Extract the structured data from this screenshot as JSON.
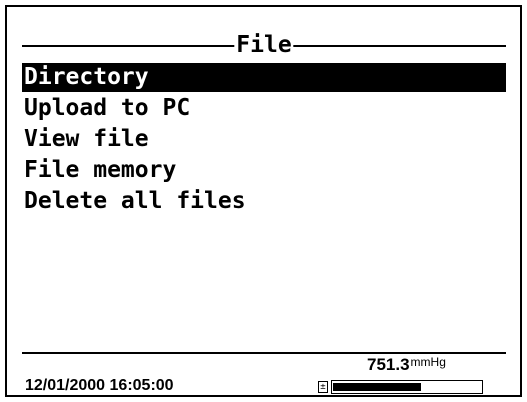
{
  "screen": {
    "title": "File",
    "menu": {
      "items": [
        {
          "label": "Directory",
          "selected": true
        },
        {
          "label": "Upload to PC",
          "selected": false
        },
        {
          "label": "View file",
          "selected": false
        },
        {
          "label": "File memory",
          "selected": false
        },
        {
          "label": "Delete all files",
          "selected": false
        }
      ]
    },
    "status": {
      "datetime": "12/01/2000 16:05:00",
      "pressure_value": "751.3",
      "pressure_unit": "mmHg",
      "battery_level": 0.6,
      "battery_icon": "battery-plus-icon"
    }
  },
  "colors": {
    "foreground": "#000000",
    "background": "#ffffff"
  }
}
